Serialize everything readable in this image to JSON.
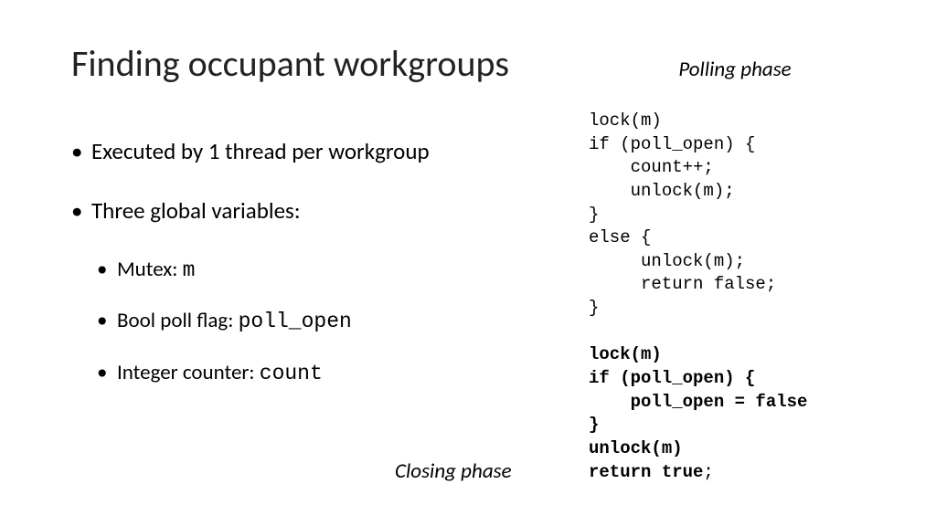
{
  "title": "Finding occupant workgroups",
  "polling_phase_label": "Polling phase",
  "closing_phase_label": "Closing phase",
  "bullets": {
    "b1": "Executed by 1 thread per workgroup",
    "b2": "Three global variables:",
    "sub1_prefix": "Mutex: ",
    "sub1_code": "m",
    "sub2_prefix": "Bool poll flag: ",
    "sub2_code": "poll_open",
    "sub3_prefix": "Integer counter: ",
    "sub3_code": "count"
  },
  "code": {
    "l1": "lock(m)",
    "l2": "if (poll_open) {",
    "l3": "    count++;",
    "l4": "    unlock(m);",
    "l5": "}",
    "l6": "else {",
    "l7": "     unlock(m);",
    "l8": "     return false;",
    "l9": "}",
    "blank": "",
    "b1": "lock(m)",
    "b2": "if (poll_open) {",
    "b3": "    poll_open = false",
    "b4": "}",
    "b5": "unlock(m)",
    "b6": "return true",
    "semi": ";"
  }
}
